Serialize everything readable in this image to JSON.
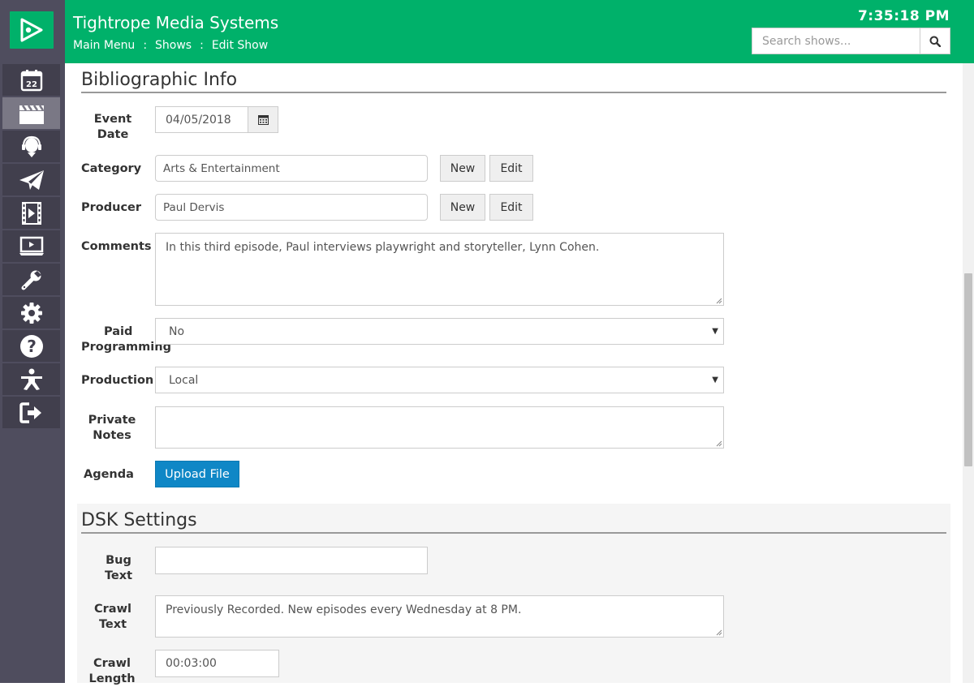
{
  "header": {
    "title": "Tightrope Media Systems",
    "clock": "7:35:18 PM",
    "breadcrumb": [
      "Main Menu",
      "Shows",
      "Edit Show"
    ],
    "search_placeholder": "Search shows..."
  },
  "sidebar": {
    "items": [
      {
        "name": "calendar",
        "icon": "calendar-icon",
        "badge": "22"
      },
      {
        "name": "shows",
        "icon": "clapperboard-icon",
        "active": true
      },
      {
        "name": "hosts",
        "icon": "headset-icon"
      },
      {
        "name": "send",
        "icon": "paper-plane-icon"
      },
      {
        "name": "video",
        "icon": "film-icon"
      },
      {
        "name": "display",
        "icon": "monitor-play-icon"
      },
      {
        "name": "tools",
        "icon": "wrench-icon"
      },
      {
        "name": "settings",
        "icon": "gear-icon"
      },
      {
        "name": "help",
        "icon": "question-icon"
      },
      {
        "name": "accessibility",
        "icon": "person-icon"
      },
      {
        "name": "logout",
        "icon": "sign-out-icon"
      }
    ]
  },
  "bibliographic": {
    "heading": "Bibliographic Info",
    "event_date_label_1": "Event",
    "event_date_label_2": "Date",
    "event_date_value": "04/05/2018",
    "category_label": "Category",
    "category_value": "Arts & Entertainment",
    "producer_label": "Producer",
    "producer_value": "Paul Dervis",
    "new_label": "New",
    "edit_label": "Edit",
    "comments_label": "Comments",
    "comments_value": "In this third episode, Paul interviews playwright and storyteller, Lynn Cohen.",
    "paid_label_1": "Paid",
    "paid_label_2": "Programming",
    "paid_value": "No",
    "production_label": "Production",
    "production_value": "Local",
    "private_label_1": "Private",
    "private_label_2": "Notes",
    "private_value": "",
    "agenda_label": "Agenda",
    "upload_label": "Upload File"
  },
  "dsk": {
    "heading": "DSK Settings",
    "bug_label_1": "Bug",
    "bug_label_2": "Text",
    "bug_value": "",
    "crawl_label_1": "Crawl",
    "crawl_label_2": "Text",
    "crawl_value": "Previously Recorded. New episodes every Wednesday at 8 PM.",
    "crawl_length_label_1": "Crawl",
    "crawl_length_label_2": "Length",
    "crawl_length_value": "00:03:00"
  },
  "colors": {
    "brand": "#00b16a",
    "sidebar": "#4f4d5e",
    "primary_button": "#0f87c6"
  }
}
